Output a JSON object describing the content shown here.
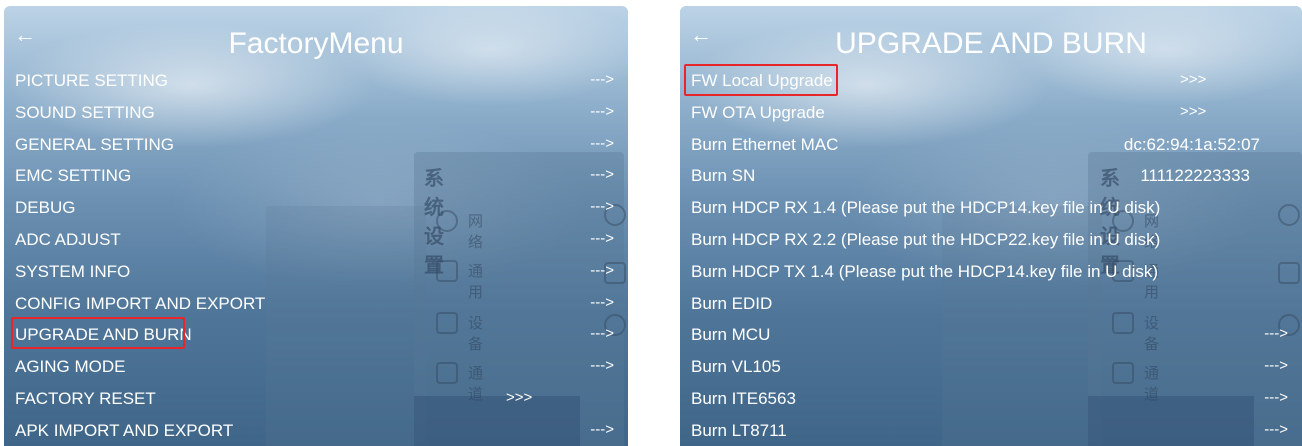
{
  "left": {
    "title": "FactoryMenu",
    "back_icon": "back-arrow-icon",
    "background_widget": {
      "title": "系统设置",
      "items": [
        "网络",
        "通用",
        "设备",
        "通道"
      ]
    },
    "items": [
      {
        "label": "PICTURE SETTING",
        "value": "--->"
      },
      {
        "label": "SOUND SETTING",
        "value": "--->"
      },
      {
        "label": "GENERAL SETTING",
        "value": "--->"
      },
      {
        "label": "EMC SETTING",
        "value": "--->"
      },
      {
        "label": "DEBUG",
        "value": "--->"
      },
      {
        "label": "ADC ADJUST",
        "value": "--->"
      },
      {
        "label": "SYSTEM INFO",
        "value": "--->"
      },
      {
        "label": "CONFIG IMPORT AND EXPORT",
        "value": "--->"
      },
      {
        "label": "UPGRADE AND BURN",
        "value": "--->"
      },
      {
        "label": "AGING MODE",
        "value": "--->"
      },
      {
        "label": "FACTORY RESET",
        "value": ">>>"
      },
      {
        "label": "APK IMPORT AND EXPORT",
        "value": "--->"
      }
    ],
    "highlighted": "UPGRADE AND BURN"
  },
  "right": {
    "title": "UPGRADE AND BURN",
    "back_icon": "back-arrow-icon",
    "background_widget": {
      "title": "系统设置",
      "items": [
        "网络",
        "通用",
        "设备",
        "通道"
      ]
    },
    "items": [
      {
        "label": "FW Local Upgrade",
        "value": ">>>"
      },
      {
        "label": "FW OTA Upgrade",
        "value": ">>>"
      },
      {
        "label": "Burn Ethernet MAC",
        "value": "dc:62:94:1a:52:07"
      },
      {
        "label": "Burn SN",
        "value": "111122223333"
      },
      {
        "label": "Burn HDCP RX 1.4 (Please put the HDCP14.key file in U disk)",
        "value": ""
      },
      {
        "label": "Burn HDCP RX 2.2 (Please put the HDCP22.key file in U disk)",
        "value": ""
      },
      {
        "label": "Burn HDCP TX 1.4 (Please put the HDCP14.key file in U disk)",
        "value": ""
      },
      {
        "label": "Burn EDID",
        "value": ""
      },
      {
        "label": "Burn MCU",
        "value": "--->"
      },
      {
        "label": "Burn VL105",
        "value": "--->"
      },
      {
        "label": "Burn ITE6563",
        "value": "--->"
      },
      {
        "label": "Burn LT8711",
        "value": "--->"
      }
    ],
    "highlighted": "FW Local Upgrade"
  },
  "colors": {
    "highlight_border": "#e8262a",
    "text": "#ffffff"
  }
}
